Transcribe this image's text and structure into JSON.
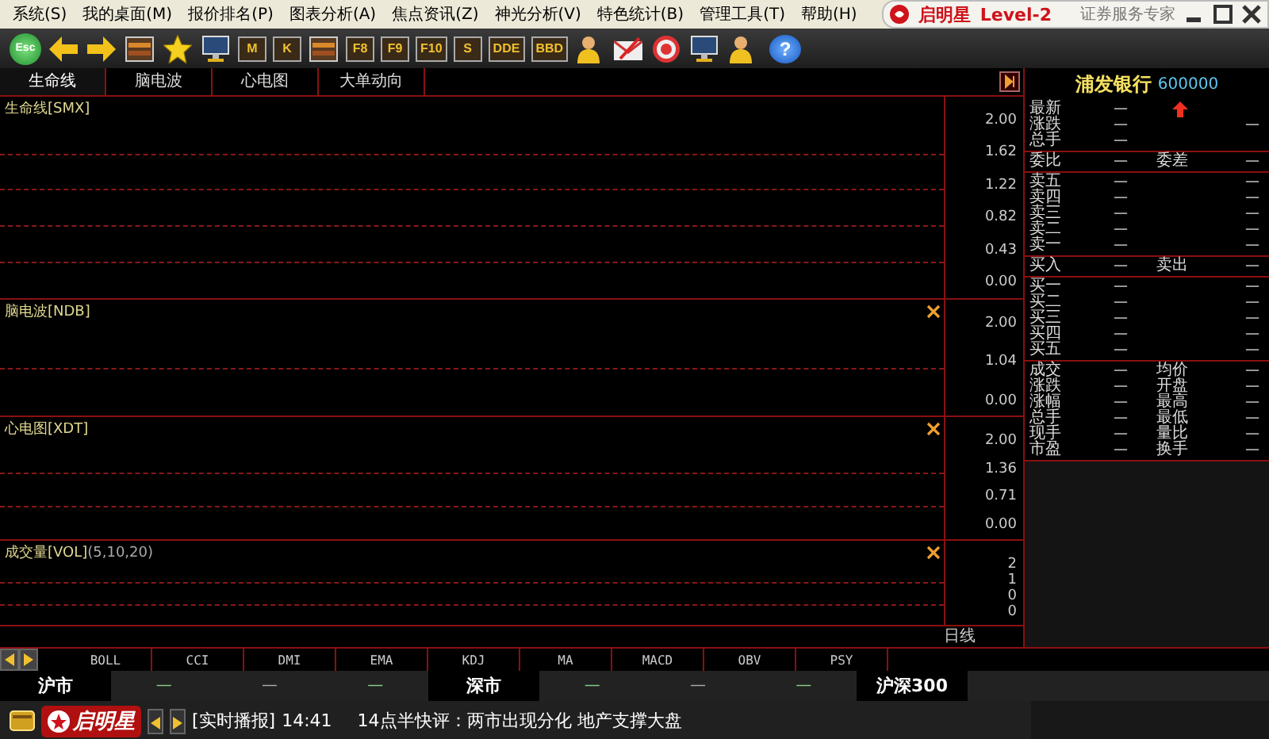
{
  "menu": [
    "系统(S)",
    "我的桌面(M)",
    "报价排名(P)",
    "图表分析(A)",
    "焦点资讯(Z)",
    "神光分析(V)",
    "特色统计(B)",
    "管理工具(T)",
    "帮助(H)"
  ],
  "brand": {
    "name": "启明星",
    "edition": "Level-2",
    "slogan": "证券服务专家"
  },
  "toolbar": [
    {
      "kind": "esc",
      "label": "Esc"
    },
    {
      "kind": "back"
    },
    {
      "kind": "forward"
    },
    {
      "kind": "panel"
    },
    {
      "kind": "star"
    },
    {
      "kind": "monitor"
    },
    {
      "kind": "key",
      "label": "M"
    },
    {
      "kind": "key",
      "label": "K"
    },
    {
      "kind": "panel"
    },
    {
      "kind": "key",
      "label": "F8"
    },
    {
      "kind": "key",
      "label": "F9"
    },
    {
      "kind": "key",
      "label": "F10"
    },
    {
      "kind": "key",
      "label": "S"
    },
    {
      "kind": "key",
      "label": "DDE"
    },
    {
      "kind": "key",
      "label": "BBD"
    },
    {
      "kind": "person"
    },
    {
      "kind": "mail"
    },
    {
      "kind": "target"
    },
    {
      "kind": "monitor"
    },
    {
      "kind": "person"
    },
    {
      "kind": "help",
      "label": "?"
    }
  ],
  "tabs": [
    {
      "label": "生命线",
      "selected": true
    },
    {
      "label": "脑电波",
      "selected": false
    },
    {
      "label": "心电图",
      "selected": false
    },
    {
      "label": "大单动向",
      "selected": false
    }
  ],
  "panes": [
    {
      "title": "生命线[SMX]",
      "closable": false,
      "ticks": [
        "2.00",
        "1.62",
        "1.22",
        "0.82",
        "0.43",
        "0.00"
      ]
    },
    {
      "title": "脑电波[NDB]",
      "closable": true,
      "ticks": [
        "2.00",
        "1.04",
        "0.00"
      ]
    },
    {
      "title": "心电图[XDT]",
      "closable": true,
      "ticks": [
        "2.00",
        "1.36",
        "0.71",
        "0.00"
      ]
    },
    {
      "title": "成交量[VOL]",
      "params": "(5,10,20)",
      "closable": true,
      "ticks": [
        "2",
        "1",
        "0",
        "0"
      ]
    }
  ],
  "period": "日线",
  "indicators": [
    "BOLL",
    "CCI",
    "DMI",
    "EMA",
    "KDJ",
    "MA",
    "MACD",
    "OBV",
    "PSY"
  ],
  "markets": [
    {
      "name": "沪市",
      "values": [
        "—",
        "—",
        "—"
      ]
    },
    {
      "name": "深市",
      "values": [
        "—",
        "—",
        "—"
      ]
    },
    {
      "name": "沪深300"
    }
  ],
  "ticker": {
    "logo": "启明星",
    "tag": "[实时播报]",
    "time": "14:41",
    "headline": "14点半快评：两市出现分化  地产支撑大盘"
  },
  "quote": {
    "name": "浦发银行",
    "code": "600000",
    "groups": [
      [
        {
          "l1": "最新",
          "v1": "—",
          "rising": true
        },
        {
          "l1": "涨跌",
          "v1": "—",
          "v2": "—"
        },
        {
          "l1": "总手",
          "v1": "—"
        }
      ],
      [
        {
          "l1": "委比",
          "v1": "—",
          "l2": "委差",
          "v2": "—"
        }
      ],
      [
        {
          "l1": "卖五",
          "v1": "—",
          "v2": "—"
        },
        {
          "l1": "卖四",
          "v1": "—",
          "v2": "—"
        },
        {
          "l1": "卖三",
          "v1": "—",
          "v2": "—"
        },
        {
          "l1": "卖二",
          "v1": "—",
          "v2": "—"
        },
        {
          "l1": "卖一",
          "v1": "—",
          "v2": "—"
        }
      ],
      [
        {
          "l1": "买入",
          "v1": "—",
          "l2": "卖出",
          "v2": "—"
        }
      ],
      [
        {
          "l1": "买一",
          "v1": "—",
          "v2": "—"
        },
        {
          "l1": "买二",
          "v1": "—",
          "v2": "—"
        },
        {
          "l1": "买三",
          "v1": "—",
          "v2": "—"
        },
        {
          "l1": "买四",
          "v1": "—",
          "v2": "—"
        },
        {
          "l1": "买五",
          "v1": "—",
          "v2": "—"
        }
      ],
      [
        {
          "l1": "成交",
          "v1": "—",
          "l2": "均价",
          "v2": "—"
        },
        {
          "l1": "涨跌",
          "v1": "—",
          "l2": "开盘",
          "v2": "—"
        },
        {
          "l1": "涨幅",
          "v1": "—",
          "l2": "最高",
          "v2": "—"
        },
        {
          "l1": "总手",
          "v1": "—",
          "l2": "最低",
          "v2": "—"
        },
        {
          "l1": "现手",
          "v1": "—",
          "l2": "量比",
          "v2": "—"
        },
        {
          "l1": "市盈",
          "v1": "—",
          "l2": "换手",
          "v2": "—"
        }
      ]
    ]
  }
}
